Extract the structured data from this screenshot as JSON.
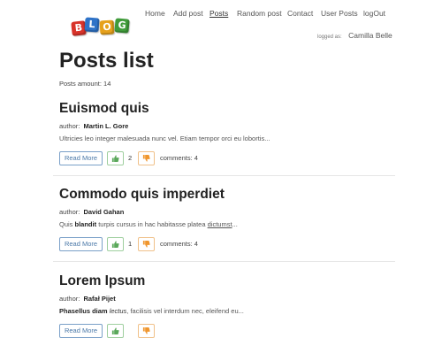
{
  "header": {
    "logo_letters": [
      "B",
      "L",
      "O",
      "G"
    ],
    "nav": [
      {
        "label": "Home",
        "active": false
      },
      {
        "label": "Add post",
        "active": false
      },
      {
        "label": "Posts",
        "active": true
      },
      {
        "label": "Random post",
        "active": false
      },
      {
        "label": "Contact",
        "active": false
      },
      {
        "label": "User Posts",
        "active": false
      },
      {
        "label": "logOut",
        "active": false
      }
    ],
    "logged_as_label": "logged as:",
    "logged_user": "Camilla Belle"
  },
  "main": {
    "title": "Posts list",
    "posts_amount": "Posts amount: 14",
    "read_more_label": "Read More",
    "author_prefix": "author:",
    "posts": [
      {
        "title": "Euismod quis",
        "author": "Martin L. Gore",
        "excerpt": {
          "segments": [
            {
              "text": "Ultricies leo integer malesuada nunc vel. Etiam tempor orci eu lobortis...",
              "style": "normal"
            }
          ]
        },
        "likes": "2",
        "comments": "comments: 4"
      },
      {
        "title": "Commodo quis imperdiet",
        "author": "David Gahan",
        "excerpt": {
          "segments": [
            {
              "text": "Quis ",
              "style": "normal"
            },
            {
              "text": "blandit",
              "style": "bold"
            },
            {
              "text": " turpis cursus in hac habitasse platea ",
              "style": "normal"
            },
            {
              "text": "dictumst",
              "style": "underline"
            },
            {
              "text": "...",
              "style": "normal"
            }
          ]
        },
        "likes": "1",
        "comments": "comments: 4"
      },
      {
        "title": "Lorem Ipsum",
        "author": "Rafał Pijet",
        "excerpt": {
          "segments": [
            {
              "text": "Phasellus diam",
              "style": "bold"
            },
            {
              "text": " ",
              "style": "normal"
            },
            {
              "text": "lectus",
              "style": "italic"
            },
            {
              "text": ", facilisis vel interdum nec, eleifend eu...",
              "style": "normal"
            }
          ]
        },
        "likes": "",
        "comments": ""
      }
    ]
  },
  "colors": {
    "like_icon": "#5aa85a",
    "dislike_icon": "#f0962e",
    "read_more_border": "#7aa0c8"
  },
  "icons": {
    "like": "thumbs-up-icon",
    "dislike": "thumbs-down-icon"
  }
}
